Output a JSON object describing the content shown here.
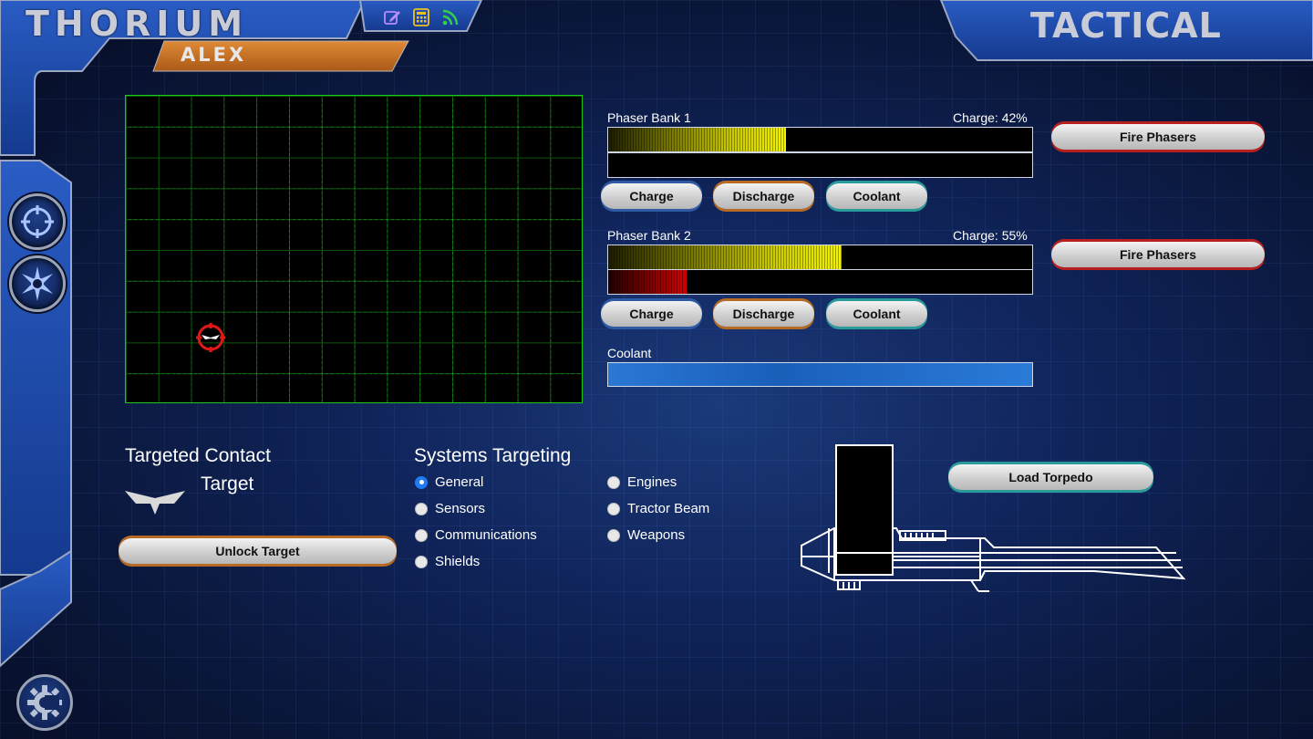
{
  "app": {
    "brand": "THORIUM",
    "client_name": "ALEX",
    "station": "TACTICAL"
  },
  "top_icons": [
    "edit-icon",
    "calculator-icon",
    "rss-icon"
  ],
  "side_nav": [
    "targeting-icon",
    "phasers-icon",
    "settings-gear-icon"
  ],
  "phasers": [
    {
      "name": "Phaser Bank 1",
      "charge_label": "Charge: 42%",
      "charge": 0.42,
      "heat": 0.0,
      "buttons": {
        "charge": "Charge",
        "discharge": "Discharge",
        "coolant": "Coolant"
      },
      "fire": "Fire Phasers"
    },
    {
      "name": "Phaser Bank 2",
      "charge_label": "Charge: 55%",
      "charge": 0.55,
      "heat": 0.185,
      "buttons": {
        "charge": "Charge",
        "discharge": "Discharge",
        "coolant": "Coolant"
      },
      "fire": "Fire Phasers"
    }
  ],
  "coolant": {
    "label": "Coolant",
    "level": 1.0
  },
  "targeted_contact": {
    "heading": "Targeted Contact",
    "name": "Target",
    "unlock_label": "Unlock Target"
  },
  "systems_targeting": {
    "heading": "Systems Targeting",
    "options": [
      "General",
      "Sensors",
      "Communications",
      "Shields",
      "Engines",
      "Tractor Beam",
      "Weapons"
    ],
    "selected": "General"
  },
  "torpedo": {
    "load_label": "Load Torpedo"
  },
  "colors": {
    "frame_blue": "#1d4aa8",
    "frame_orange": "#c8782c",
    "grid_green": "#19c819",
    "selected_radio": "#1e7bf2"
  }
}
